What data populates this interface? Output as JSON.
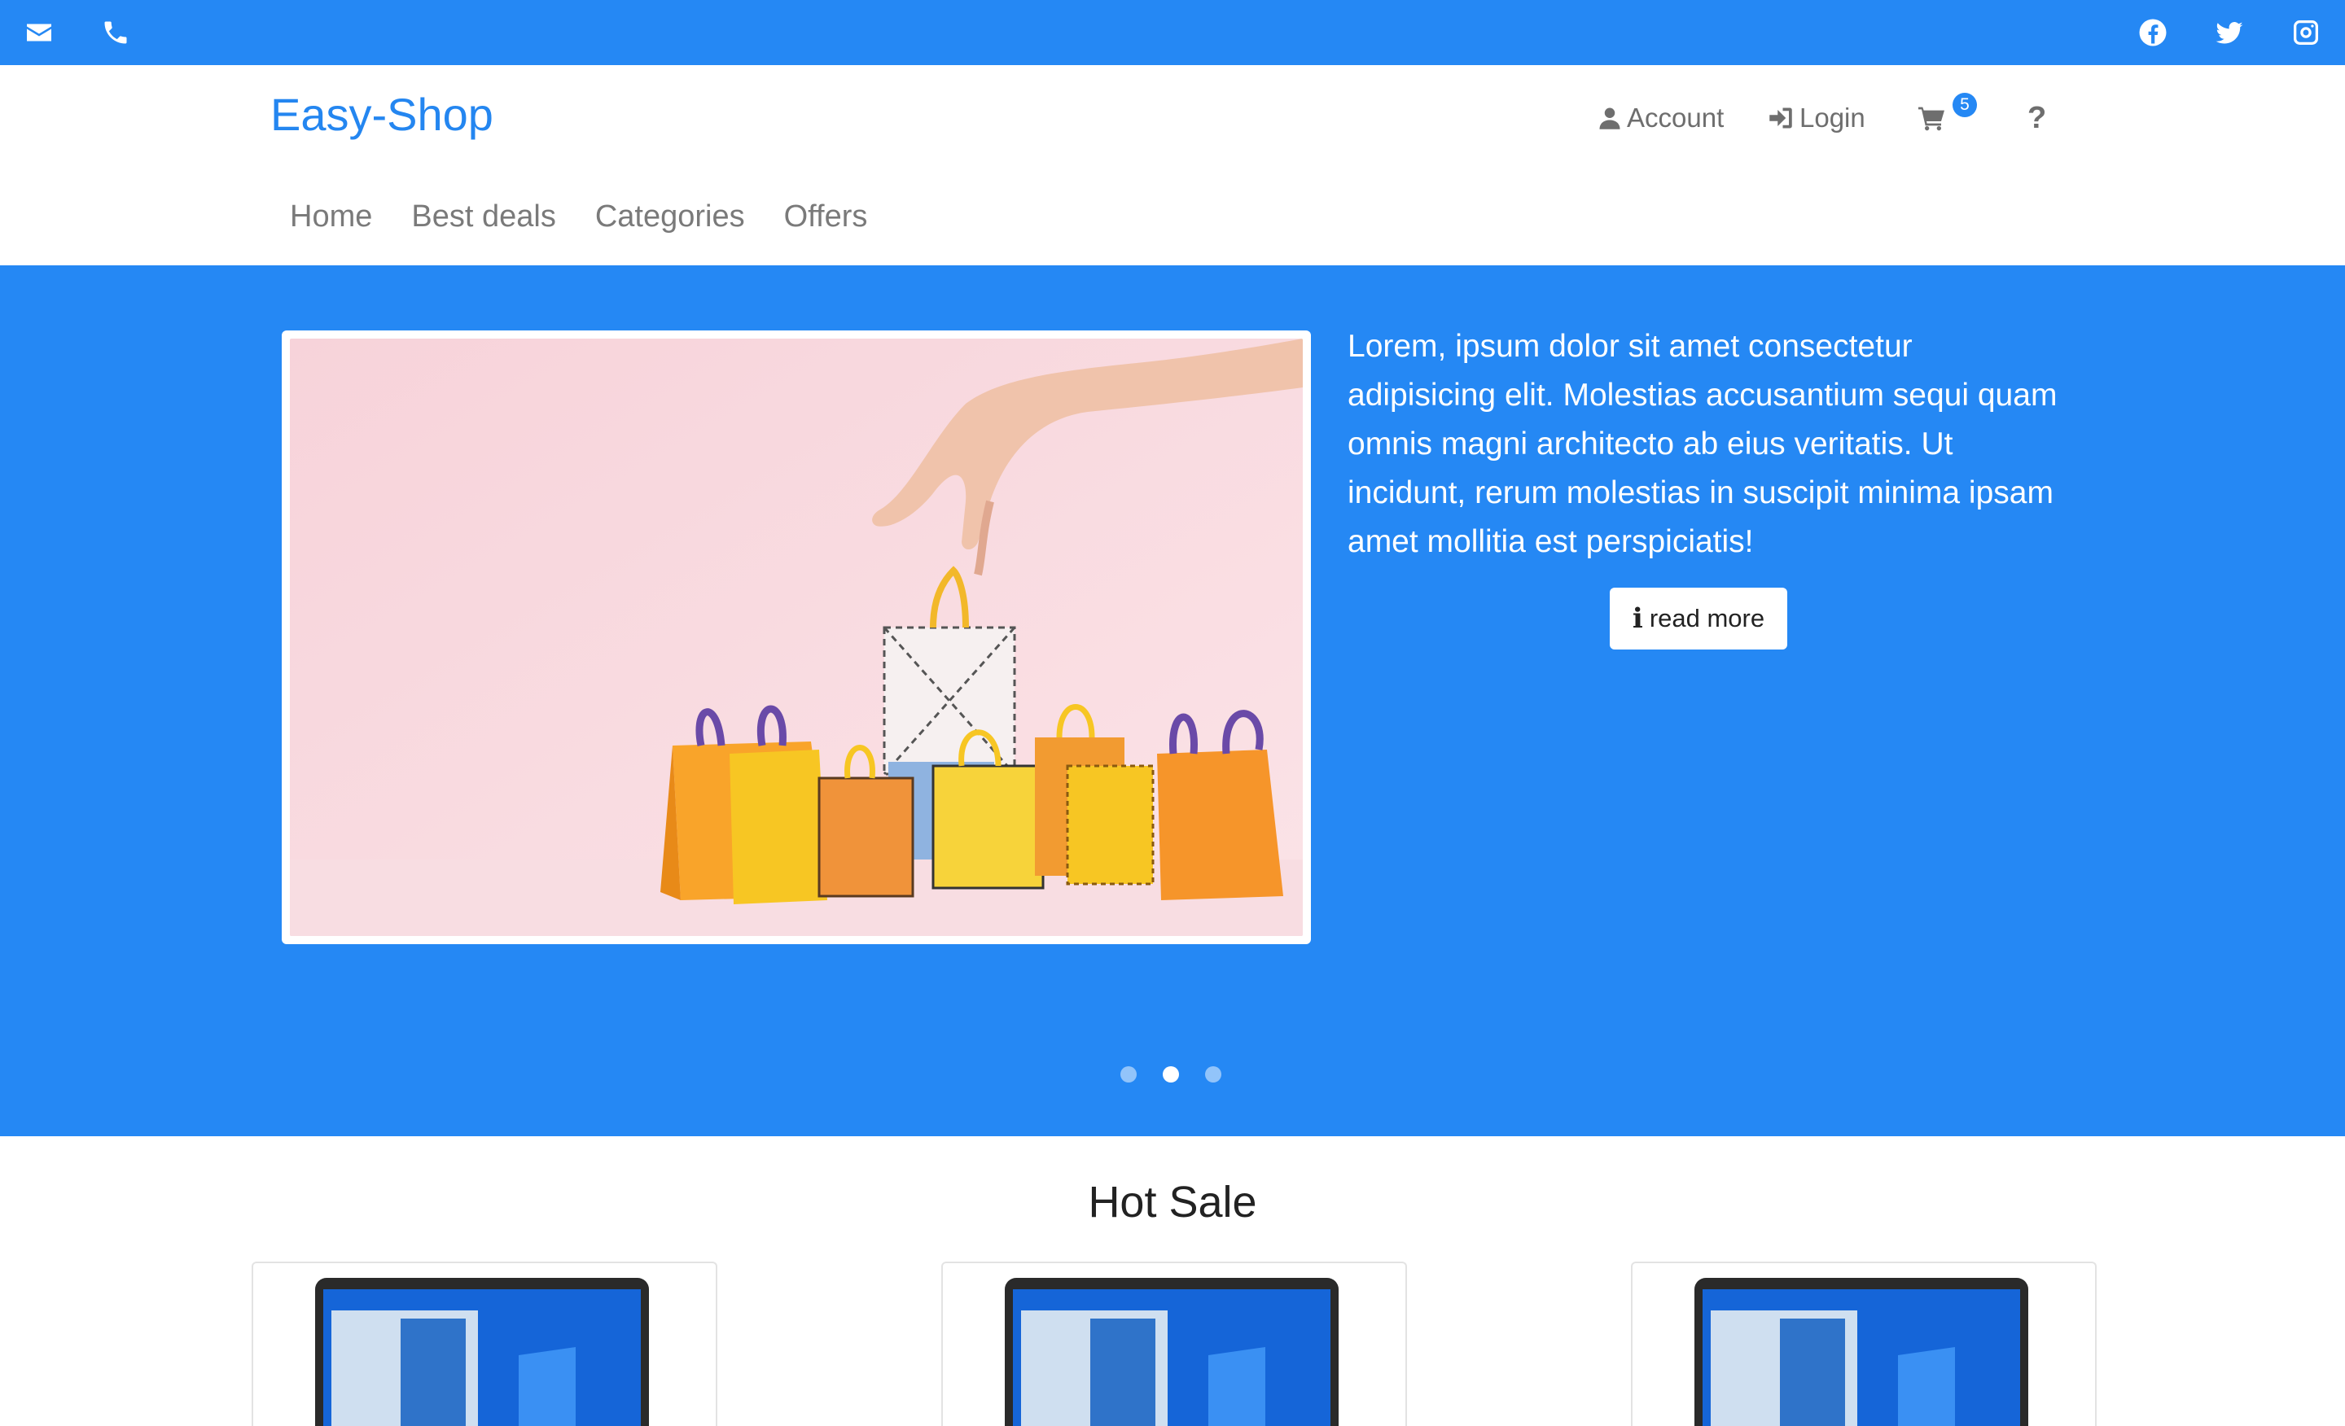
{
  "topbar": {
    "left_icons": [
      "envelope-icon",
      "phone-icon"
    ],
    "right_icons": [
      "facebook-icon",
      "twitter-icon",
      "instagram-icon"
    ]
  },
  "header": {
    "brand": "Easy-Shop",
    "account_label": "Account",
    "login_label": "Login",
    "cart_count": "5",
    "help_label": "?"
  },
  "nav": {
    "items": [
      {
        "label": "Home"
      },
      {
        "label": "Best deals"
      },
      {
        "label": "Categories"
      },
      {
        "label": "Offers"
      }
    ]
  },
  "hero": {
    "text": "Lorem, ipsum dolor sit amet consectetur adipisicing elit. Molestias accusantium sequi quam omnis magni architecto ab eius veritatis. Ut incidunt, rerum molestias in suscipit minima ipsam amet mollitia est perspiciatis!",
    "button_label": "read more",
    "button_icon": "i",
    "slides": 3,
    "active_slide": 2
  },
  "section": {
    "title": "Hot Sale"
  },
  "colors": {
    "primary": "#2588f4",
    "brand": "#2486f0"
  }
}
